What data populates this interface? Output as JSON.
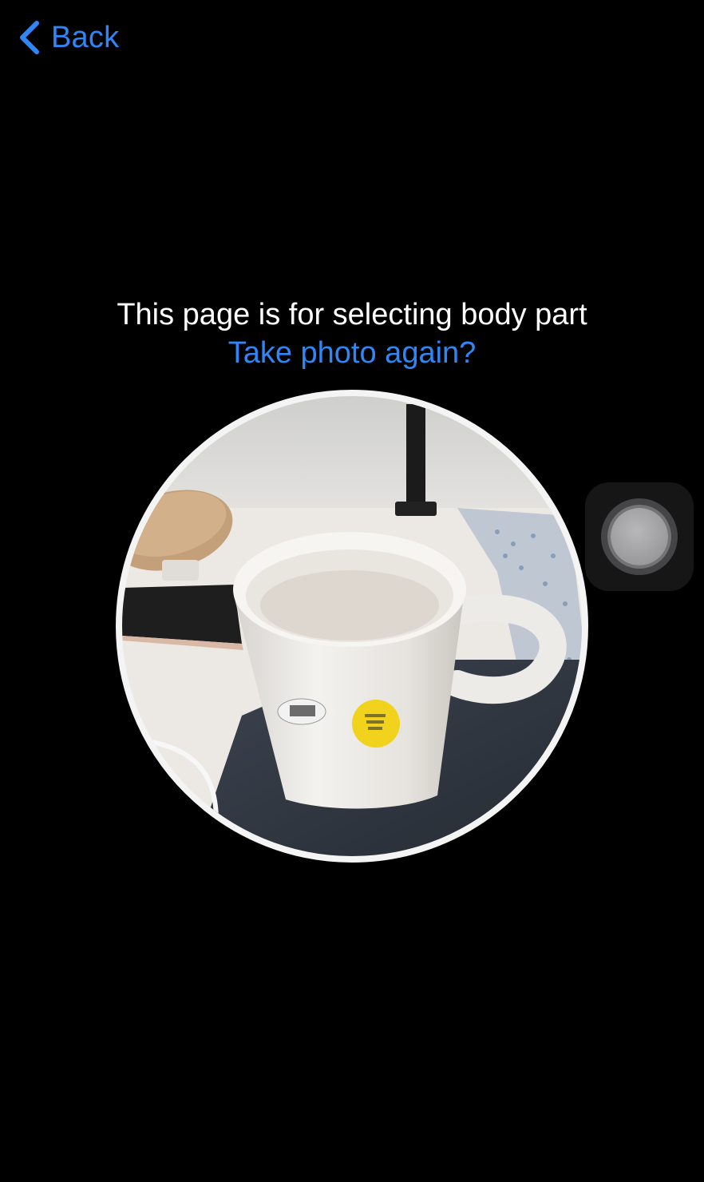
{
  "nav": {
    "back_label": "Back",
    "back_icon": "chevron-left-icon"
  },
  "prompt": {
    "message": "This page is for selecting body part",
    "retake_link": "Take photo again?"
  },
  "photo": {
    "icon": "captured-photo"
  },
  "assistive_touch": {
    "icon": "assistive-touch-icon"
  },
  "colors": {
    "background": "#000000",
    "accent": "#2f86f6",
    "text": "#ffffff"
  }
}
